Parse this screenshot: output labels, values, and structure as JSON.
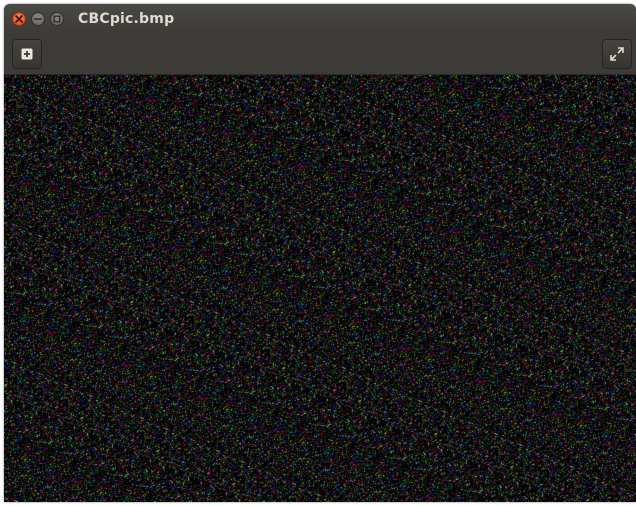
{
  "window": {
    "title": "CBCpic.bmp"
  },
  "titlebar": {
    "buttons": [
      {
        "name": "close",
        "icon": "close-icon"
      },
      {
        "name": "minimize",
        "icon": "minimize-icon"
      },
      {
        "name": "maximize",
        "icon": "maximize-icon"
      }
    ]
  },
  "toolbar": {
    "left_icon": "add-icon",
    "right_icon": "fullscreen-icon"
  },
  "image": {
    "description_icon": "noise-image",
    "colors": {
      "close": "#e1461c",
      "window_bg": "#3c3b37",
      "title_text": "#dfdbd2"
    }
  }
}
